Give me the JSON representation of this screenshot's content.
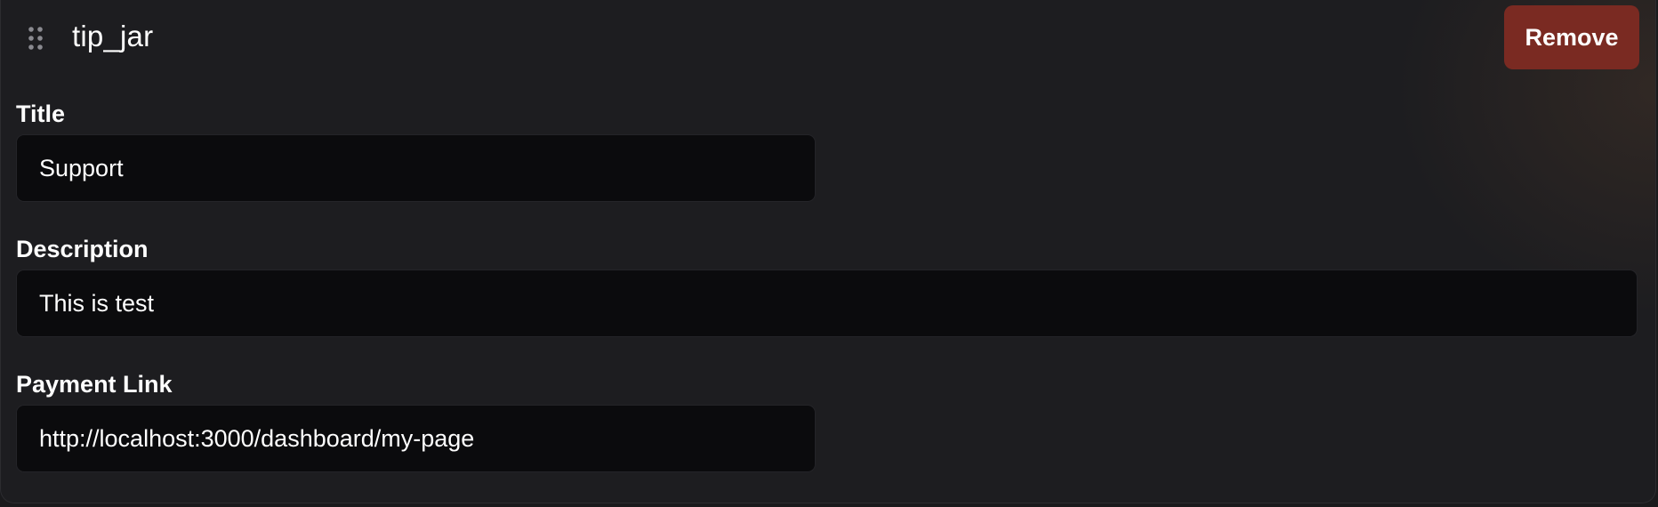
{
  "widget": {
    "name": "tip_jar",
    "remove_label": "Remove",
    "drag_icon": "drag-handle-icon"
  },
  "fields": {
    "title": {
      "label": "Title",
      "value": "Support"
    },
    "description": {
      "label": "Description",
      "value": "This is test"
    },
    "payment_link": {
      "label": "Payment Link",
      "value": "http://localhost:3000/dashboard/my-page"
    }
  },
  "colors": {
    "background": "#1d1d20",
    "input_background": "#0b0b0d",
    "remove_button": "#7a2a22",
    "text": "#ffffff",
    "drag_handle": "#8a8a90"
  }
}
